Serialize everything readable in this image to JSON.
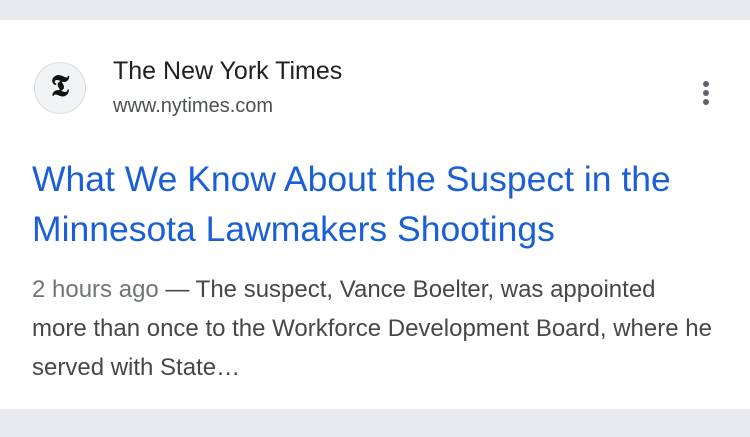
{
  "result": {
    "source": {
      "favicon_glyph": "𝕿",
      "favicon_icon": "nyt-logo-icon",
      "name": "The New York Times",
      "url": "www.nytimes.com"
    },
    "menu_icon": "more-vert-icon",
    "headline": "What We Know About the Suspect in the Minnesota Lawmakers Shootings",
    "snippet": {
      "date": "2 hours ago",
      "separator": " — ",
      "text": "The suspect, Vance Boelter, was appointed more than once to the Workforce Development Board, where he served with State…"
    }
  },
  "colors": {
    "headline": "#1a5fd6",
    "background": "#e9eaee",
    "card": "#ffffff"
  }
}
